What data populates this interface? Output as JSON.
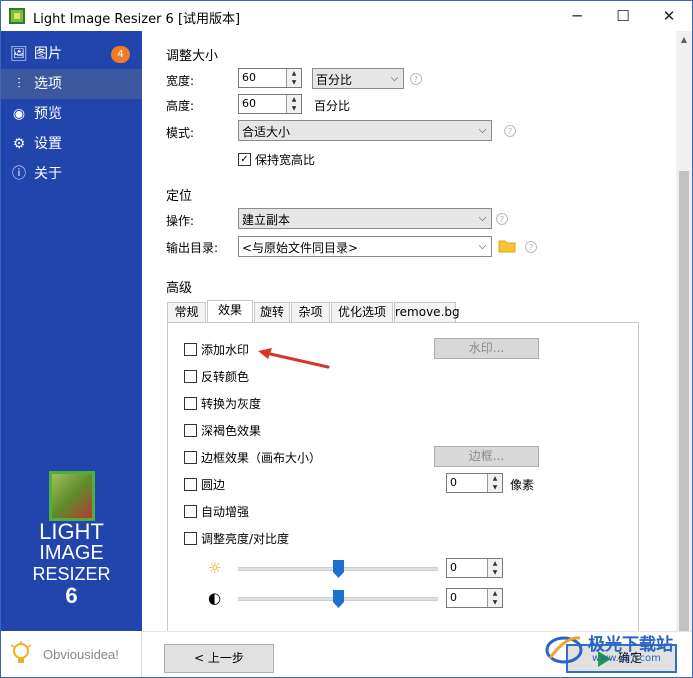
{
  "window": {
    "title": "Light Image Resizer 6  [试用版本]",
    "min": "─",
    "max": "☐",
    "close": "✕"
  },
  "sidebar": {
    "items": [
      {
        "label": "图片",
        "icon": "images-icon",
        "glyph": "🖼",
        "badge": "4"
      },
      {
        "label": "选项",
        "icon": "sliders-icon",
        "glyph": "⫶"
      },
      {
        "label": "预览",
        "icon": "eye-icon",
        "glyph": "◉"
      },
      {
        "label": "设置",
        "icon": "gear-icon",
        "glyph": "⚙"
      },
      {
        "label": "关于",
        "icon": "info-icon",
        "glyph": "ⓘ"
      }
    ],
    "logo": {
      "line1": "LIGHT",
      "line2": "IMAGE",
      "line3": "RESIZER",
      "line4": "6"
    },
    "brand": "Obviousidea!"
  },
  "resize": {
    "heading": "调整大小",
    "width_label": "宽度:",
    "width_value": "60",
    "unit_select": "百分比",
    "height_label": "高度:",
    "height_value": "60",
    "height_unit": "百分比",
    "mode_label": "模式:",
    "mode_value": "合适大小",
    "keep_ratio_label": "保持宽高比",
    "keep_ratio_checked": "✓"
  },
  "position": {
    "heading": "定位",
    "action_label": "操作:",
    "action_value": "建立副本",
    "output_label": "输出目录:",
    "output_value": "<与原始文件同目录>"
  },
  "advanced": {
    "heading": "高级",
    "tabs": [
      "常规",
      "效果",
      "旋转",
      "杂项",
      "优化选项",
      "remove.bg"
    ],
    "options": {
      "watermark": "添加水印",
      "invert": "反转颜色",
      "grayscale": "转换为灰度",
      "sepia": "深褐色效果",
      "border": "边框效果（画布大小）",
      "round": "圆边",
      "auto": "自动增强",
      "bright": "调整亮度/对比度"
    },
    "watermark_btn": "水印...",
    "border_btn": "边框...",
    "round_value": "0",
    "round_unit": "像素",
    "brightness_value": "0",
    "contrast_value": "0",
    "brightness_level": 0.5,
    "contrast_level": 0.5,
    "brightness_icon": "☼",
    "contrast_icon": "◐"
  },
  "footer": {
    "back": "< 上一步",
    "ok": "确定"
  },
  "watermark_overlay": {
    "name": "极光下载站",
    "url": "www.xz7.com"
  },
  "colors": {
    "sidebar": "#2245ad",
    "accent": "#f07a28",
    "arrow": "#d9342b"
  }
}
